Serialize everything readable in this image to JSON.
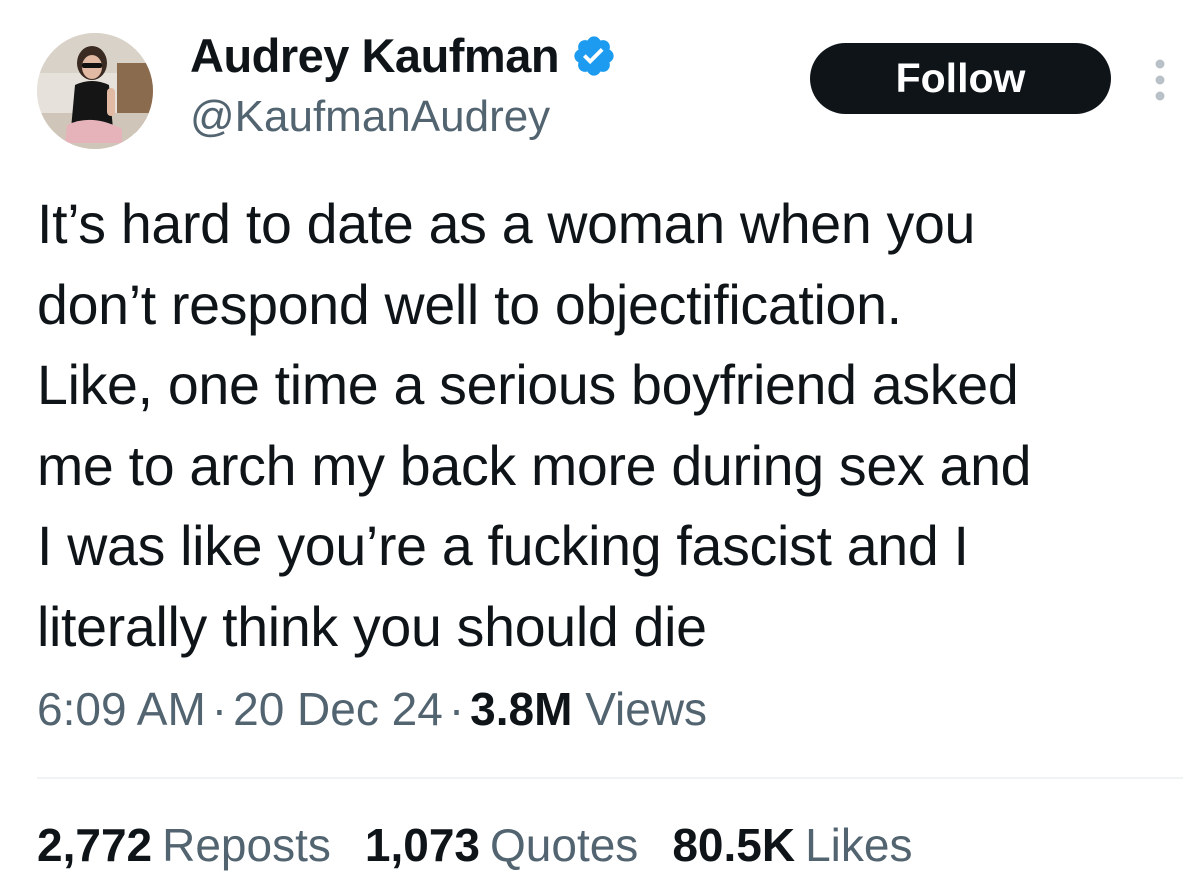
{
  "author": {
    "display_name": "Audrey Kaufman",
    "handle": "@KaufmanAudrey",
    "verified": true
  },
  "actions": {
    "follow_label": "Follow"
  },
  "tweet": {
    "text": "It’s hard to date as a woman when you\ndon’t respond well to objectification.\nLike, one time a serious boyfriend asked\nme to arch my back more during sex and\nI was like you’re a fucking fascist and I\nliterally think you should die",
    "time": "6:09 AM",
    "date": "20 Dec 24",
    "separator": "·",
    "views_count": "3.8M",
    "views_label": "Views"
  },
  "stats": {
    "reposts_count": "2,772",
    "reposts_label": "Reposts",
    "quotes_count": "1,073",
    "quotes_label": "Quotes",
    "likes_count": "80.5K",
    "likes_label": "Likes"
  },
  "icons": {
    "verified": "verified-badge-icon",
    "more": "more-options-icon"
  },
  "colors": {
    "text_primary": "#0f1419",
    "text_secondary": "#536471",
    "verified_blue": "#1d9bf0",
    "follow_bg": "#0f1419",
    "divider": "#eff3f4"
  }
}
